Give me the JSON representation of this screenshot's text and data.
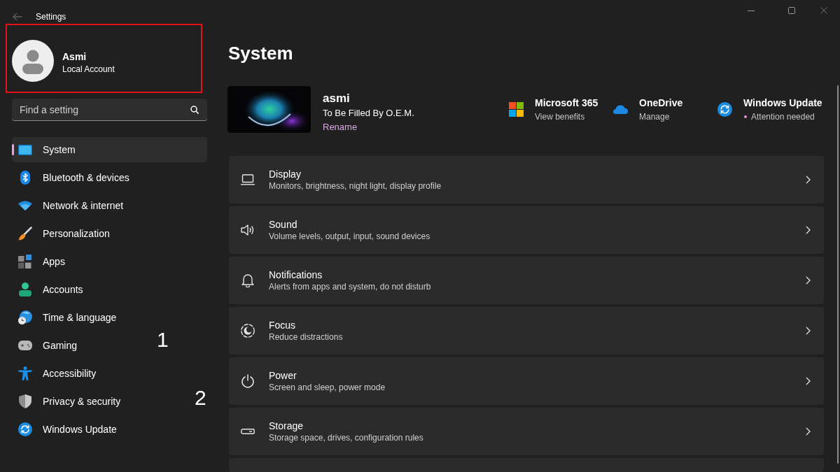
{
  "window": {
    "title": "Settings",
    "back_button": {
      "disabled": true
    }
  },
  "profile": {
    "name": "Asmi",
    "account_type": "Local Account",
    "highlighted": true
  },
  "search": {
    "placeholder": "Find a setting"
  },
  "sidebar": {
    "items": [
      {
        "label": "System",
        "selected": true
      },
      {
        "label": "Bluetooth & devices",
        "selected": false
      },
      {
        "label": "Network & internet",
        "selected": false
      },
      {
        "label": "Personalization",
        "selected": false
      },
      {
        "label": "Apps",
        "selected": false
      },
      {
        "label": "Accounts",
        "selected": false
      },
      {
        "label": "Time & language",
        "selected": false
      },
      {
        "label": "Gaming",
        "selected": false,
        "annotation": "1"
      },
      {
        "label": "Accessibility",
        "selected": false
      },
      {
        "label": "Privacy & security",
        "selected": false,
        "annotation": "2"
      },
      {
        "label": "Windows Update",
        "selected": false
      }
    ]
  },
  "page": {
    "title": "System"
  },
  "device": {
    "name": "asmi",
    "model": "To Be Filled By O.E.M.",
    "rename_link": "Rename"
  },
  "quick_links": [
    {
      "title": "Microsoft 365",
      "subtitle": "View benefits",
      "alert": false
    },
    {
      "title": "OneDrive",
      "subtitle": "Manage",
      "alert": false
    },
    {
      "title": "Windows Update",
      "subtitle": "Attention needed",
      "alert": true
    }
  ],
  "settings": [
    {
      "kind": "entry",
      "title": "Display",
      "subtitle": "Monitors, brightness, night light, display profile"
    },
    {
      "kind": "entry",
      "title": "Sound",
      "subtitle": "Volume levels, output, input, sound devices"
    },
    {
      "kind": "entry",
      "title": "Notifications",
      "subtitle": "Alerts from apps and system, do not disturb"
    },
    {
      "kind": "entry",
      "title": "Focus",
      "subtitle": "Reduce distractions"
    },
    {
      "kind": "entry",
      "title": "Power",
      "subtitle": "Screen and sleep, power mode"
    },
    {
      "kind": "entry",
      "title": "Storage",
      "subtitle": "Storage space, drives, configuration rules"
    },
    {
      "kind": "partial"
    }
  ]
}
